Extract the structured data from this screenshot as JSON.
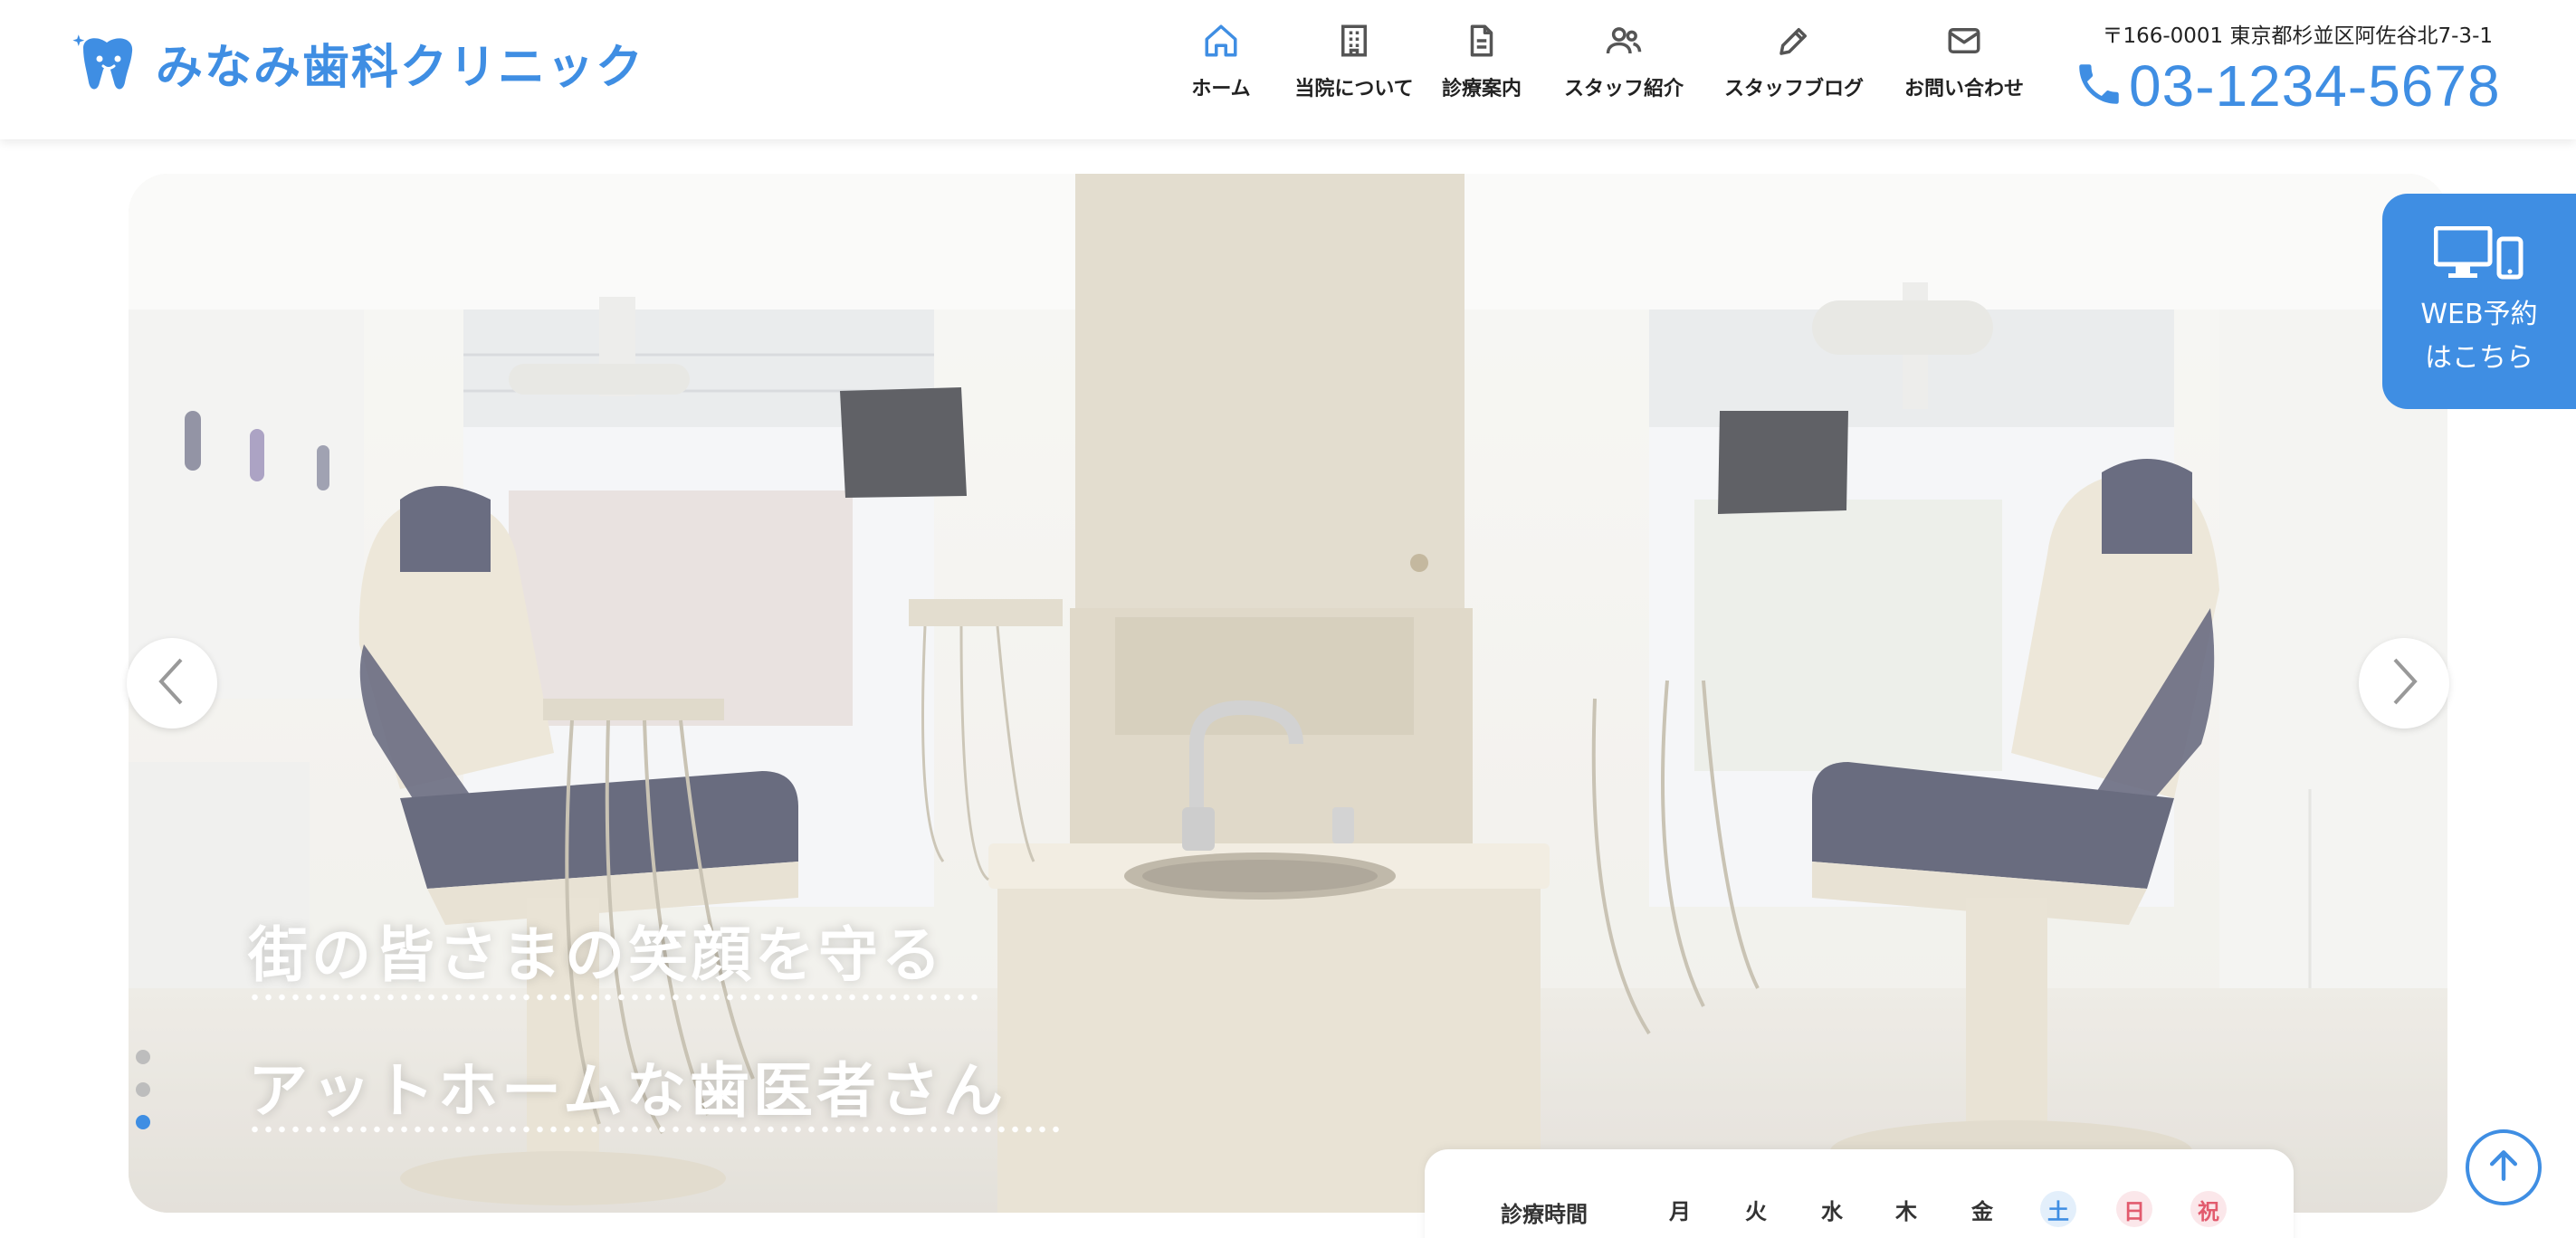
{
  "header": {
    "logo_text": "みなみ歯科クリニック",
    "address": "〒166-0001 東京都杉並区阿佐谷北7-3-1",
    "phone": "03-1234-5678"
  },
  "nav": [
    {
      "label": "ホーム",
      "icon": "home-icon"
    },
    {
      "label": "当院について",
      "icon": "building-icon"
    },
    {
      "label": "診療案内",
      "icon": "document-icon"
    },
    {
      "label": "スタッフ紹介",
      "icon": "people-icon"
    },
    {
      "label": "スタッフブログ",
      "icon": "pencil-icon"
    },
    {
      "label": "お問い合わせ",
      "icon": "mail-icon"
    }
  ],
  "hero": {
    "catch_line1": "街の皆さまの笑顔を守る",
    "catch_line2": "アットホームな歯医者さん",
    "slide_count": 3,
    "active_slide": 3
  },
  "web_reservation": {
    "line1": "WEB予約",
    "line2": "はこちら",
    "icon": "devices-icon"
  },
  "hours": {
    "label": "診療時間",
    "days": [
      "月",
      "火",
      "水",
      "木",
      "金",
      "土",
      "日",
      "祝"
    ]
  },
  "colors": {
    "accent": "#3f8ee3",
    "sunday": "#e25b6e"
  }
}
